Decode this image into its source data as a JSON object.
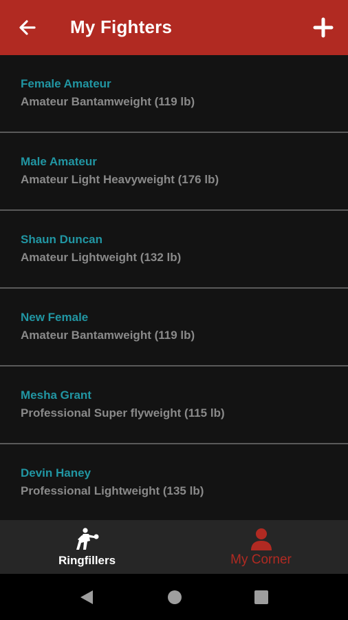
{
  "app_bar": {
    "title": "My Fighters",
    "back_icon": "arrow-left-icon",
    "add_icon": "plus-icon",
    "color": "#b12a22"
  },
  "fighters": [
    {
      "name": "Female Amateur",
      "division": "Amateur Bantamweight (119 lb)"
    },
    {
      "name": "Male Amateur",
      "division": "Amateur Light Heavyweight (176 lb)"
    },
    {
      "name": "Shaun Duncan",
      "division": "Amateur Lightweight (132 lb)"
    },
    {
      "name": "New Female",
      "division": "Amateur Bantamweight (119 lb)"
    },
    {
      "name": "Mesha Grant",
      "division": "Professional Super flyweight (115 lb)"
    },
    {
      "name": "Devin Haney",
      "division": "Professional Lightweight (135 lb)"
    }
  ],
  "bottom_nav": {
    "tabs": [
      {
        "label": "Ringfillers",
        "icon": "boxer-icon",
        "active": true
      },
      {
        "label": "My Corner",
        "icon": "person-icon",
        "active": false
      }
    ]
  },
  "system_nav": {
    "back": "back-triangle-icon",
    "home": "home-circle-icon",
    "recents": "recents-square-icon"
  },
  "colors": {
    "name_text": "#2196a3",
    "sub_text": "#8a8a8a",
    "list_bg": "#131313",
    "nav_bg": "#262626"
  }
}
